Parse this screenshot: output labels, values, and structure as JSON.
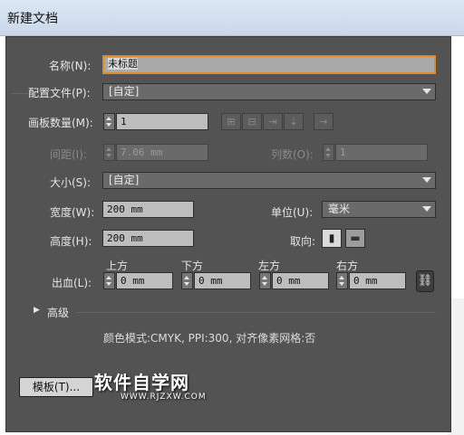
{
  "window": {
    "title": "新建文档"
  },
  "name": {
    "label": "名称(N):",
    "value": "未标题"
  },
  "profile": {
    "label": "配置文件(P):",
    "value": "[自定]"
  },
  "artboards": {
    "label": "画板数量(M):",
    "value": "1"
  },
  "spacing": {
    "label": "间距(I):",
    "value": "7.06 mm"
  },
  "columns": {
    "label": "列数(O):",
    "value": "1"
  },
  "size": {
    "label": "大小(S):",
    "value": "[自定]"
  },
  "width": {
    "label": "宽度(W):",
    "value": "200 mm"
  },
  "height": {
    "label": "高度(H):",
    "value": "200 mm"
  },
  "units": {
    "label": "单位(U):",
    "value": "毫米"
  },
  "orientation": {
    "label": "取向:",
    "portrait_icon": "portrait-icon",
    "landscape_icon": "landscape-icon"
  },
  "bleed": {
    "label": "出血(L):",
    "top": {
      "label": "上方",
      "value": "0 mm"
    },
    "bottom": {
      "label": "下方",
      "value": "0 mm"
    },
    "left": {
      "label": "左方",
      "value": "0 mm"
    },
    "right": {
      "label": "右方",
      "value": "0 mm"
    }
  },
  "advanced": {
    "label": "高级"
  },
  "info": {
    "text": "颜色模式:CMYK, PPI:300, 对齐像素网格:否"
  },
  "templates_button": {
    "label": "模板(T)..."
  },
  "watermark": {
    "title": "软件自学网",
    "url": "WWW.RJZXW.COM"
  },
  "colors": {
    "dialog_bg": "#535353",
    "focus": "#d98c2b"
  }
}
